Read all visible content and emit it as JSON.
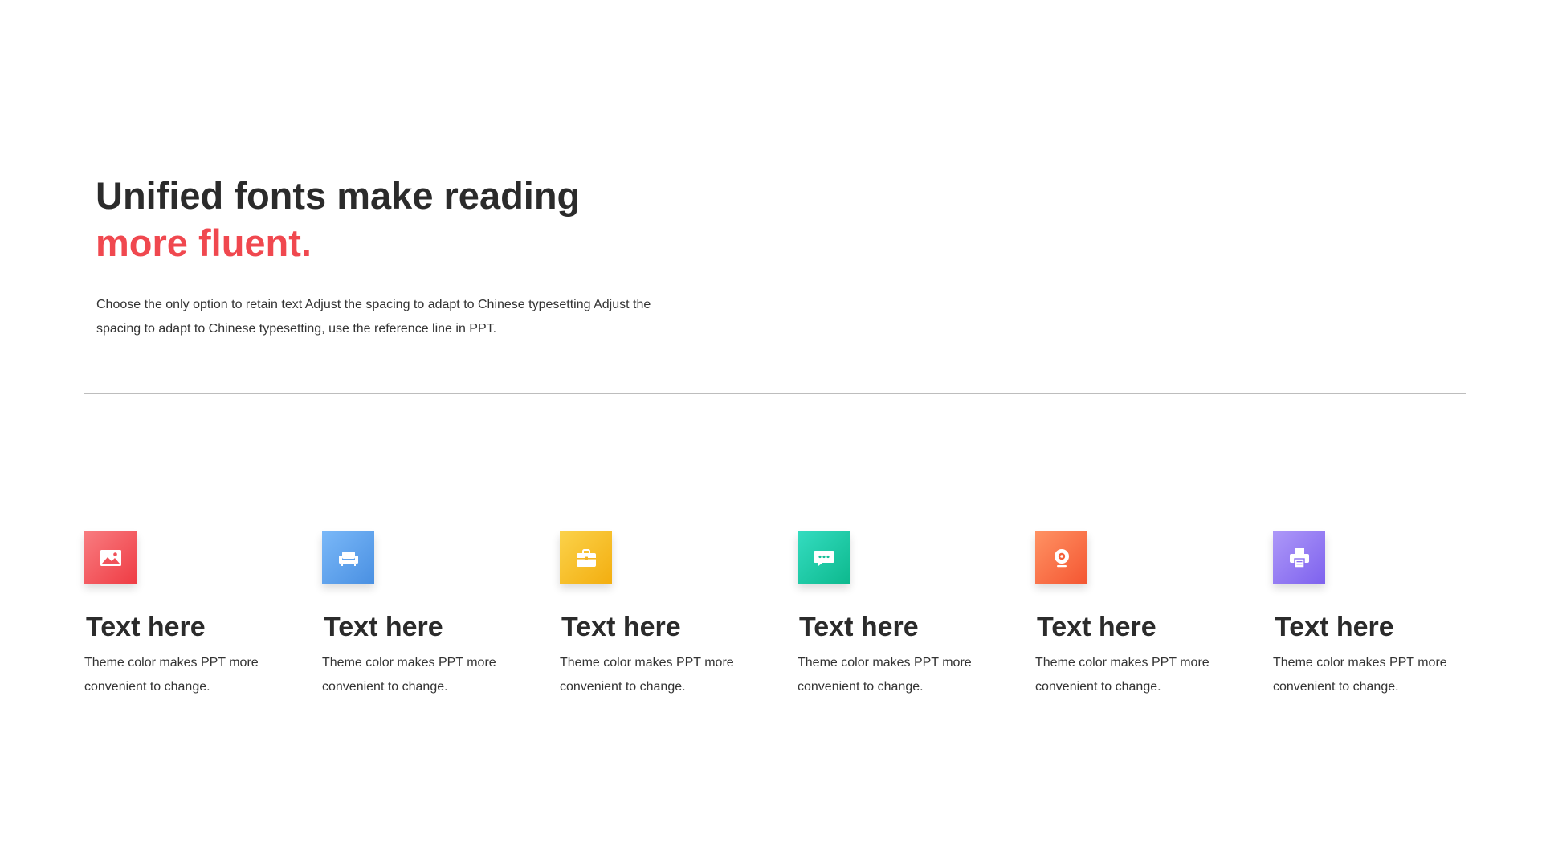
{
  "header": {
    "title_line1": "Unified fonts make reading",
    "title_line2": "more fluent.",
    "description": "Choose the only option to retain text Adjust the spacing to adapt to Chinese typesetting Adjust the spacing to adapt to Chinese typesetting, use the reference line in PPT."
  },
  "colors": {
    "title": "#2b2b2b",
    "accent": "#f0484f",
    "divider": "#bdbdbd"
  },
  "features": [
    {
      "icon": "image-icon",
      "title": "Text here",
      "description": "Theme color makes PPT more convenient to change.",
      "color_from": "#f87c80",
      "color_to": "#ef3c44"
    },
    {
      "icon": "sofa-icon",
      "title": "Text here",
      "description": "Theme color makes PPT more convenient to change.",
      "color_from": "#7ab8f8",
      "color_to": "#4a90e2"
    },
    {
      "icon": "briefcase-icon",
      "title": "Text here",
      "description": "Theme color makes PPT more convenient to change.",
      "color_from": "#fbd24a",
      "color_to": "#f3ae10"
    },
    {
      "icon": "chat-bubble-icon",
      "title": "Text here",
      "description": "Theme color makes PPT more convenient to change.",
      "color_from": "#34dcc0",
      "color_to": "#0db98e"
    },
    {
      "icon": "webcam-icon",
      "title": "Text here",
      "description": "Theme color makes PPT more convenient to change.",
      "color_from": "#ff9263",
      "color_to": "#f45632"
    },
    {
      "icon": "printer-icon",
      "title": "Text here",
      "description": "Theme color makes PPT more convenient to change.",
      "color_from": "#ad98f8",
      "color_to": "#7e62ee"
    }
  ]
}
